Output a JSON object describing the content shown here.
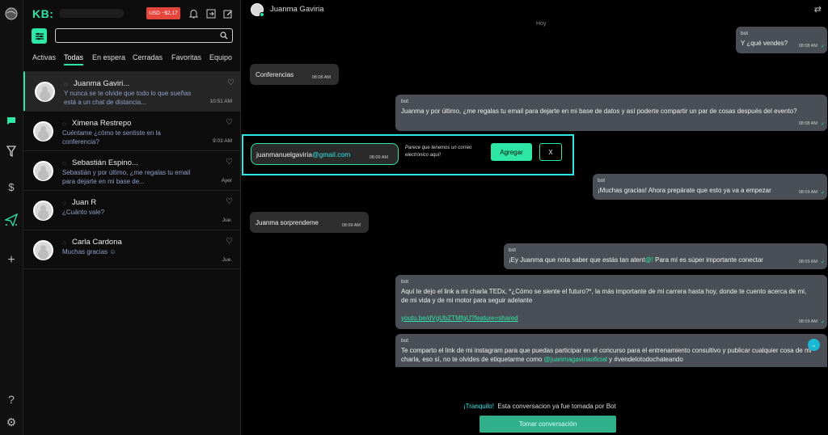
{
  "rail": {
    "icons": [
      "globe-icon",
      "chat-icon",
      "user-funnel-icon",
      "dollar-icon",
      "send-icon",
      "plus-icon",
      "help-icon",
      "gear-icon"
    ]
  },
  "sidebar": {
    "brand": "KB:",
    "balance": "USD −$2,17",
    "search_placeholder": "",
    "tabs": [
      "Activas",
      "Todas",
      "En espera",
      "Cerradas",
      "Favoritas",
      "Equipo"
    ],
    "active_tab": "Todas",
    "conversations": [
      {
        "name": "Juanma Gaviri...",
        "preview": "Y nunca se te olvide que todo lo que sueñas está a un chat de distancia...",
        "time": "10:51 AM"
      },
      {
        "name": "Ximena Restrepo",
        "preview": "Cuéntame ¿cómo te sentiste en la conferencia?",
        "time": "9:03 AM"
      },
      {
        "name": "Sebastián Espino...",
        "preview": "Sebastián y por último, ¿me regalas tu email para dejarte en mi base de...",
        "time": "Ayer"
      },
      {
        "name": "Juan R",
        "preview": "¿Cuánto vale?",
        "time": "Jue."
      },
      {
        "name": "Carla Cardona",
        "preview": "Muchas gracias ☺",
        "time": "Jue."
      }
    ]
  },
  "chat": {
    "contact_name": "Juanma Gaviria",
    "day_label": "Hoy",
    "messages": [
      {
        "who": "bot",
        "text": "Y ¿qué vendes?",
        "time": "08:08 AM"
      },
      {
        "who": "",
        "text": "Conferencias",
        "time": "08:08 AM"
      },
      {
        "who": "bot",
        "text": "Juanma y por último, ¿me regalas tu email para dejarte en mi base de datos y así poderte compartir un par de cosas después del evento?",
        "time": "08:08 AM"
      },
      {
        "who": "bot",
        "text": "¡Muchas gracias! Ahora prepárate que esto ya va a empezar",
        "time": "08:09 AM"
      },
      {
        "who": "",
        "text": "Juanma sorprendeme",
        "time": "08:09 AM"
      },
      {
        "who": "bot",
        "text_a": "¡Ey Juanma que nota saber que estás tan atent",
        "text_hl": "@!",
        "text_b": " Para mí es súper importante conectar",
        "time": "08:09 AM"
      },
      {
        "who": "bot",
        "text": "Aquí te dejo el link a mi charla TEDx, *¿Cómo se siente el futuro?*, la más importante de mi carrera hasta hoy, donde te cuento acerca de mi, de mi vida y de mi motor para seguir adelante",
        "link": "youtu.be/dVgUbZTMfgU?feature=shared",
        "time": "08:09 AM"
      },
      {
        "who": "bot",
        "text_a": "Te comparto el link de mi instagram para que puedas participar en el concurso para el entrenamiento consultivo y publicar cualquier cosa de mi charla, eso sí, no te olvides de etiquetarme como ",
        "text_hl": "@juanmagaviriaoficial",
        "text_b": " y #vendelotodochateando"
      }
    ],
    "email_detect": {
      "email_user": "juanmanuelgaviria",
      "email_domain": "@gmail.com",
      "time": "08:09 AM",
      "note": "Parece que tenemos un correo electrónico aquí!",
      "add_label": "Agregar",
      "dismiss_label": "X"
    },
    "footer": {
      "tranquilo": "¡Tranquilo!",
      "taken_text": "Esta conversacion ya fue tomada por Bot",
      "take_button": "Tomar conversación"
    }
  },
  "colors": {
    "accent": "#2ee6a6",
    "highlight": "#2ee6e6",
    "balance": "#e6453b",
    "out_bubble": "#4a4f57",
    "in_bubble": "#2e2e2e"
  }
}
